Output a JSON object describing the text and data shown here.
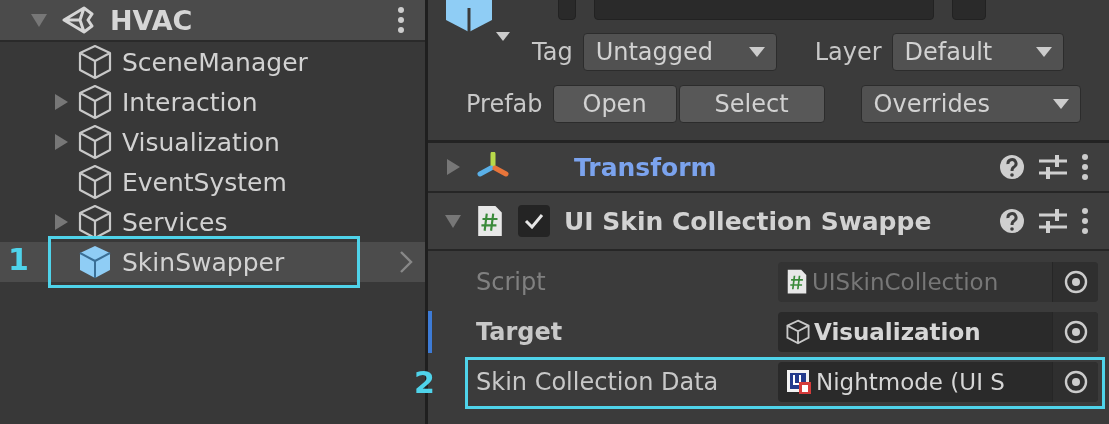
{
  "hierarchy": {
    "root": {
      "label": "HVAC",
      "expanded": true,
      "children": [
        {
          "label": "SceneManager",
          "has_children": false,
          "prefab": false,
          "selected": false
        },
        {
          "label": "Interaction",
          "has_children": true,
          "prefab": false,
          "selected": false
        },
        {
          "label": "Visualization",
          "has_children": true,
          "prefab": false,
          "selected": false
        },
        {
          "label": "EventSystem",
          "has_children": false,
          "prefab": false,
          "selected": false
        },
        {
          "label": "Services",
          "has_children": true,
          "prefab": false,
          "selected": false
        },
        {
          "label": "SkinSwapper",
          "has_children": false,
          "prefab": true,
          "selected": true,
          "annotation": "1"
        }
      ]
    }
  },
  "inspector": {
    "tag": {
      "label": "Tag",
      "value": "Untagged"
    },
    "layer": {
      "label": "Layer",
      "value": "Default"
    },
    "prefab": {
      "label": "Prefab",
      "buttons": [
        "Open",
        "Select"
      ],
      "overrides": "Overrides"
    },
    "components": [
      {
        "kind": "transform",
        "title": "Transform",
        "expanded": false
      },
      {
        "kind": "script",
        "title": "UI Skin Collection Swappe",
        "expanded": true,
        "enabled": true,
        "fields": [
          {
            "label": "Script",
            "kind": "script",
            "value": "UISkinCollection",
            "disabled": true,
            "overridden": false
          },
          {
            "label": "Target",
            "kind": "gameobject",
            "value": "Visualization",
            "disabled": false,
            "overridden": true
          },
          {
            "label": "Skin Collection Data",
            "kind": "asset",
            "value": "Nightmode (UI S",
            "disabled": false,
            "overridden": false,
            "annotation": "2"
          }
        ]
      }
    ]
  }
}
